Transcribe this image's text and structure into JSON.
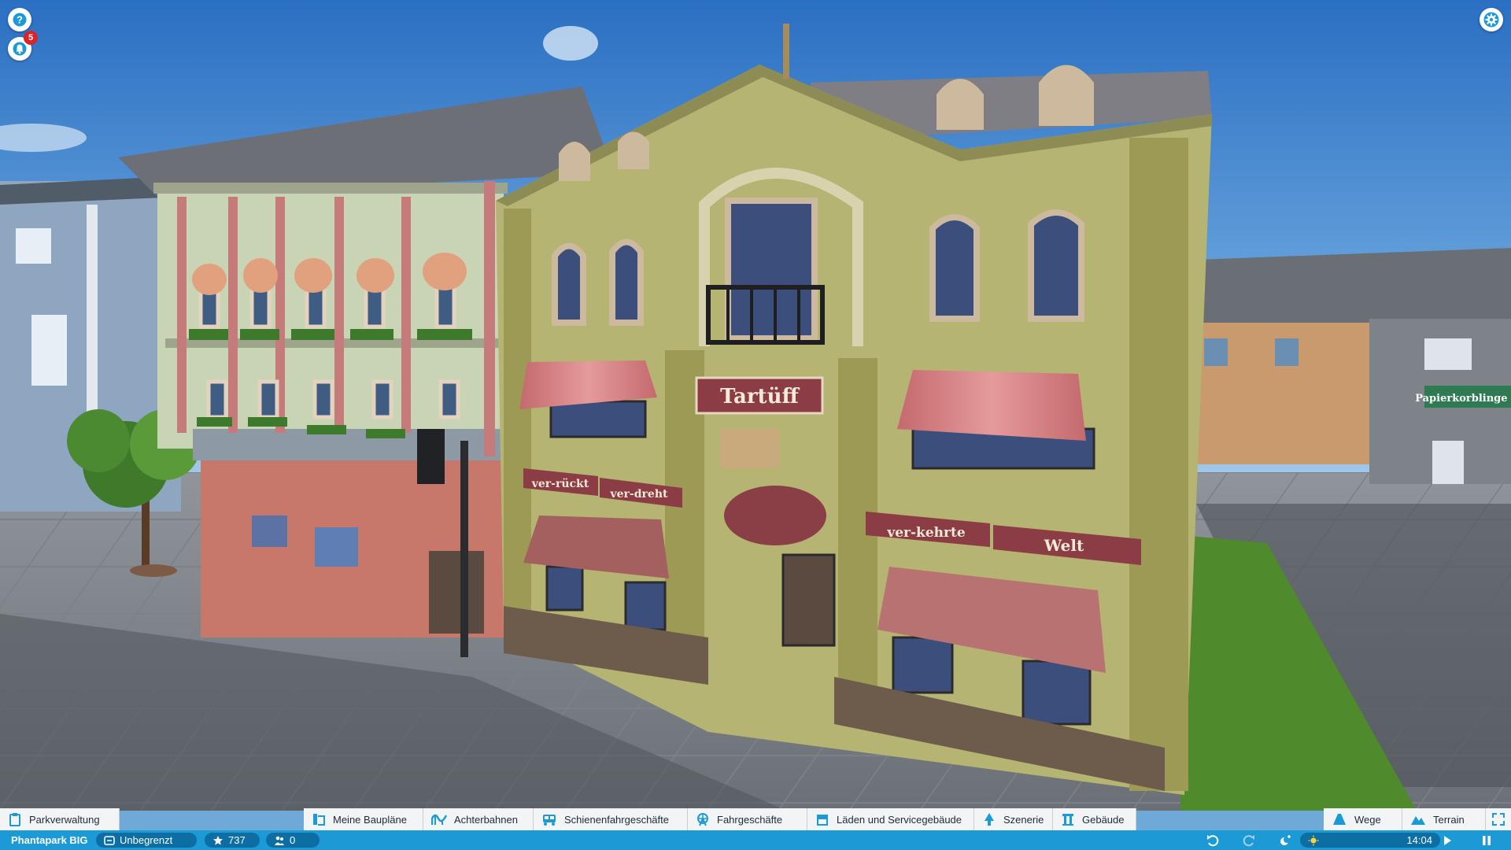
{
  "hud": {
    "help_icon": "help-icon",
    "notifications_icon": "bell-icon",
    "notifications_count": "5",
    "settings_icon": "gear-icon"
  },
  "scene": {
    "signs": {
      "main": "Tartüff",
      "left_a": "ver-rückt",
      "left_b": "ver-dreht",
      "right_a": "ver-kehrte",
      "right_b": "Welt",
      "far_right": "Papierkorblinge &"
    }
  },
  "toolbar": {
    "park_management": "Parkverwaltung",
    "blueprints": "Meine Baupläne",
    "coasters": "Achterbahnen",
    "track_rides": "Schienenfahrgeschäfte",
    "flat_rides": "Fahrgeschäfte",
    "shops": "Läden und Servicegebäude",
    "scenery": "Szenerie",
    "buildings": "Gebäude",
    "paths": "Wege",
    "terrain": "Terrain"
  },
  "status": {
    "park_name": "Phantapark BIG",
    "money": "Unbegrenzt",
    "rating": "737",
    "guests": "0",
    "time": "14:04"
  },
  "colors": {
    "accent_blue": "#1b9ad6",
    "toolbar_bg": "#f3f4f5",
    "badge_red": "#d8232a"
  }
}
